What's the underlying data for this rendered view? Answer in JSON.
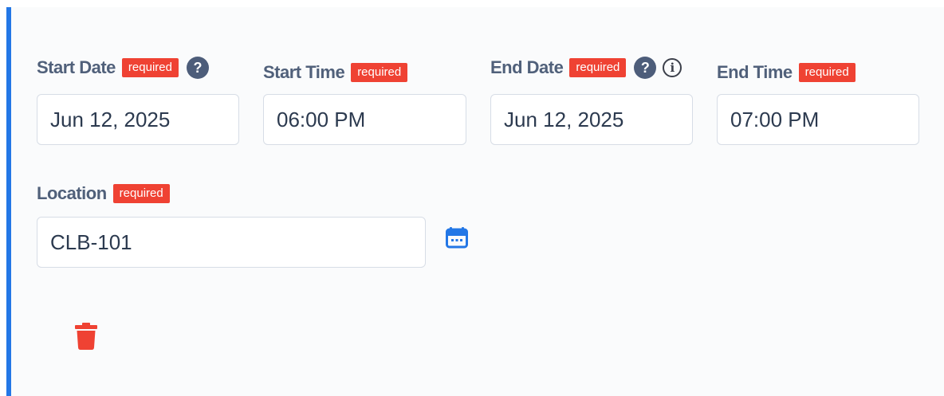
{
  "labels": {
    "start_date": "Start Date",
    "start_time": "Start Time",
    "end_date": "End Date",
    "end_time": "End Time",
    "location": "Location",
    "required": "required",
    "help": "?",
    "info": "i"
  },
  "values": {
    "start_date": "Jun 12, 2025",
    "start_time": "06:00 PM",
    "end_date": "Jun 12, 2025",
    "end_time": "07:00 PM",
    "location": "CLB-101"
  },
  "icons": {
    "help": "question-circle-icon",
    "info": "info-circle-icon",
    "calendar": "calendar-icon",
    "delete": "trash-icon"
  },
  "colors": {
    "accent": "#2377e6",
    "required_badge": "#ef4233",
    "label": "#50607a",
    "delete": "#ef4233"
  }
}
